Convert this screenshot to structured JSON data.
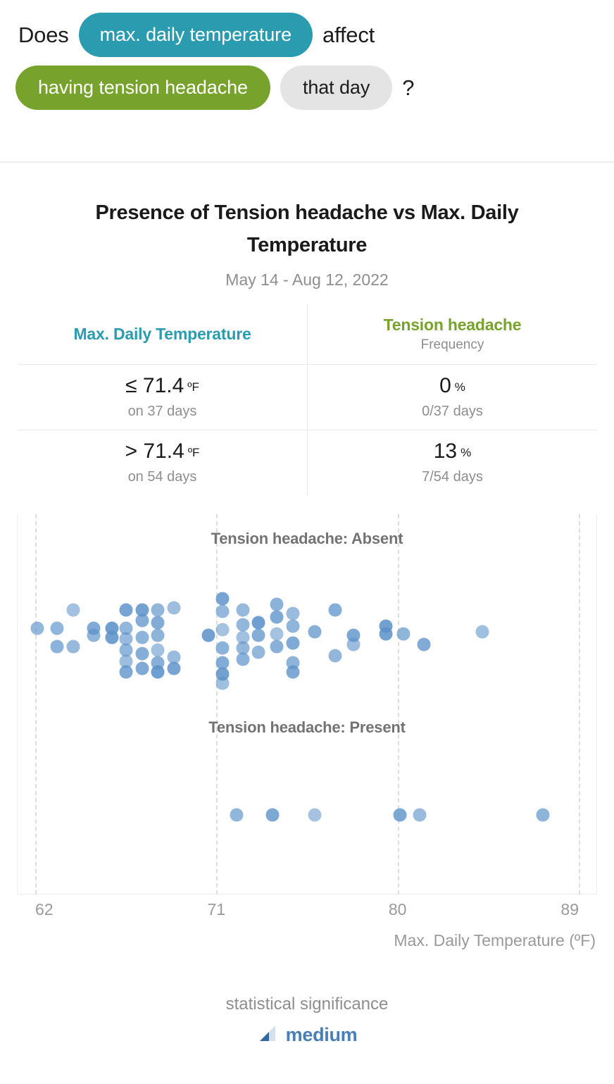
{
  "question": {
    "lead_word": "Does",
    "exposure_pill": "max. daily temperature",
    "verb_word": "affect",
    "outcome_pill": "having tension headache",
    "time_pill": "that day",
    "question_mark": "?",
    "exposure_color": "#2b9cb0",
    "outcome_color": "#77a32c",
    "time_color": "#e4e4e4"
  },
  "card": {
    "title": "Presence of Tension headache vs Max. Daily Temperature",
    "subtitle": "May 14 - Aug 12, 2022"
  },
  "table": {
    "header": {
      "exposure_label": "Max. Daily Temperature",
      "outcome_label": "Tension headache",
      "outcome_sub": "Frequency"
    },
    "rows": [
      {
        "exposure_value": "≤ 71.4",
        "exposure_unit": "ºF",
        "exposure_sub": "on 37 days",
        "outcome_value": "0",
        "outcome_unit": "%",
        "outcome_sub": "0/37 days"
      },
      {
        "exposure_value": "> 71.4",
        "exposure_unit": "ºF",
        "exposure_sub": "on 54 days",
        "outcome_value": "13",
        "outcome_unit": "%",
        "outcome_sub": "7/54 days"
      }
    ]
  },
  "footer": {
    "significance_label": "statistical significance",
    "significance_value": "medium",
    "significance_color": "#4a7fb5",
    "icon_name": "signal-bars-icon"
  },
  "chart_data": {
    "type": "scatter",
    "title": "Presence of Tension headache vs Max. Daily Temperature",
    "subtitle": "May 14 - Aug 12, 2022",
    "xlabel": "Max. Daily Temperature (ºF)",
    "ylabel": "",
    "xlim": [
      62,
      89
    ],
    "xticks": [
      62,
      71,
      80,
      89
    ],
    "xticklabels": [
      "62",
      "71",
      "80",
      "89"
    ],
    "grid": true,
    "gridlines_x": [
      62,
      71,
      80,
      89
    ],
    "legend": "none",
    "dot_color": "#5b92c9",
    "panels": [
      {
        "label": "Tension headache: Absent",
        "n": 84,
        "points": [
          {
            "x": 62.1,
            "y": 0
          },
          {
            "x": 63.1,
            "y": 0
          },
          {
            "x": 63.1,
            "y": 1
          },
          {
            "x": 63.9,
            "y": -1
          },
          {
            "x": 63.9,
            "y": 1
          },
          {
            "x": 64.9,
            "y": 0
          },
          {
            "x": 64.9,
            "y": 0.4
          },
          {
            "x": 65.8,
            "y": 0
          },
          {
            "x": 65.8,
            "y": 0.5
          },
          {
            "x": 66.5,
            "y": -1
          },
          {
            "x": 66.5,
            "y": 0
          },
          {
            "x": 66.5,
            "y": 0.6
          },
          {
            "x": 66.5,
            "y": 1.2
          },
          {
            "x": 66.5,
            "y": 1.8
          },
          {
            "x": 66.5,
            "y": 2.4
          },
          {
            "x": 67.3,
            "y": -1
          },
          {
            "x": 67.3,
            "y": -0.4
          },
          {
            "x": 67.3,
            "y": 0.5
          },
          {
            "x": 67.3,
            "y": 1.4
          },
          {
            "x": 67.3,
            "y": 2.2
          },
          {
            "x": 68.1,
            "y": -1
          },
          {
            "x": 68.1,
            "y": -0.3
          },
          {
            "x": 68.1,
            "y": 0.4
          },
          {
            "x": 68.1,
            "y": 1.2
          },
          {
            "x": 68.1,
            "y": 1.9
          },
          {
            "x": 68.1,
            "y": 2.4
          },
          {
            "x": 68.9,
            "y": -1.1
          },
          {
            "x": 68.9,
            "y": 1.6
          },
          {
            "x": 68.9,
            "y": 2.2
          },
          {
            "x": 70.6,
            "y": 0.4
          },
          {
            "x": 71.3,
            "y": -1.6
          },
          {
            "x": 71.3,
            "y": -0.9
          },
          {
            "x": 71.3,
            "y": 0.1
          },
          {
            "x": 71.3,
            "y": 1.1
          },
          {
            "x": 71.3,
            "y": 1.9
          },
          {
            "x": 71.3,
            "y": 2.5
          },
          {
            "x": 71.3,
            "y": 3.0
          },
          {
            "x": 72.3,
            "y": -1.0
          },
          {
            "x": 72.3,
            "y": -0.2
          },
          {
            "x": 72.3,
            "y": 0.5
          },
          {
            "x": 72.3,
            "y": 1.1
          },
          {
            "x": 72.3,
            "y": 1.7
          },
          {
            "x": 73.1,
            "y": -0.3
          },
          {
            "x": 73.1,
            "y": 0.4
          },
          {
            "x": 73.1,
            "y": 1.3
          },
          {
            "x": 74.0,
            "y": -1.3
          },
          {
            "x": 74.0,
            "y": -0.6
          },
          {
            "x": 74.0,
            "y": 0.3
          },
          {
            "x": 74.0,
            "y": 1.0
          },
          {
            "x": 74.8,
            "y": -0.8
          },
          {
            "x": 74.8,
            "y": -0.1
          },
          {
            "x": 74.8,
            "y": 0.8
          },
          {
            "x": 74.8,
            "y": 1.9
          },
          {
            "x": 74.8,
            "y": 2.4
          },
          {
            "x": 75.9,
            "y": 0.2
          },
          {
            "x": 76.9,
            "y": -1.0
          },
          {
            "x": 76.9,
            "y": 1.5
          },
          {
            "x": 77.8,
            "y": 0.4
          },
          {
            "x": 77.8,
            "y": 0.9
          },
          {
            "x": 79.4,
            "y": -0.1
          },
          {
            "x": 79.4,
            "y": 0.3
          },
          {
            "x": 80.3,
            "y": 0.3
          },
          {
            "x": 81.3,
            "y": 0.9
          },
          {
            "x": 84.2,
            "y": 0.2
          }
        ]
      },
      {
        "label": "Tension headache: Present",
        "n": 7,
        "points": [
          {
            "x": 72.0,
            "y": 0
          },
          {
            "x": 73.8,
            "y": 0
          },
          {
            "x": 75.9,
            "y": 0
          },
          {
            "x": 80.1,
            "y": 0
          },
          {
            "x": 81.1,
            "y": 0
          },
          {
            "x": 87.2,
            "y": 0
          }
        ]
      }
    ]
  }
}
